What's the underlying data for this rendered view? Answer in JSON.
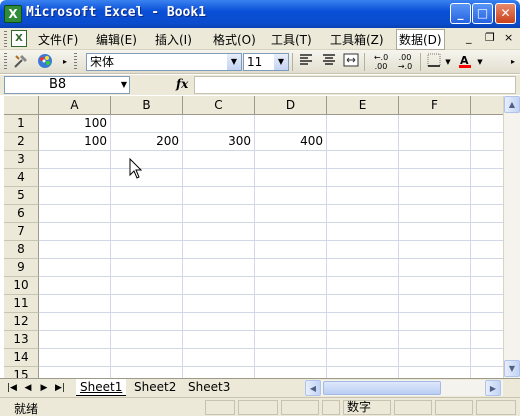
{
  "window": {
    "title": "Microsoft Excel - Book1",
    "app_icon": "excel-icon",
    "buttons": {
      "minimize": "_",
      "maximize": "□",
      "close": "✕"
    }
  },
  "menu": {
    "items": [
      "文件(F)",
      "编辑(E)",
      "插入(I)",
      "格式(O)",
      "工具(T)",
      "工具箱(Z)",
      "数据(D)"
    ],
    "mdi": {
      "minimize": "_",
      "restore": "❐",
      "close": "×"
    }
  },
  "toolbar": {
    "font_name": "宋体",
    "font_size": "11",
    "icons": [
      "tools-icon",
      "palette-icon",
      "align-left-icon",
      "align-center-icon",
      "merge-center-icon",
      "increase-decimal-icon",
      "decrease-decimal-icon",
      "borders-icon",
      "font-color-icon"
    ],
    "font_color": "#ff0000"
  },
  "formula_bar": {
    "name_box": "B8",
    "fx_label": "fx",
    "formula": ""
  },
  "sheet": {
    "columns": [
      "A",
      "B",
      "C",
      "D",
      "E",
      "F"
    ],
    "rows": [
      "1",
      "2",
      "3",
      "4",
      "5",
      "6",
      "7",
      "8",
      "9",
      "10",
      "11",
      "12",
      "13",
      "14",
      "15"
    ],
    "cells": {
      "A1": "100",
      "A2": "100",
      "B2": "200",
      "C2": "300",
      "D2": "400"
    }
  },
  "tabs": {
    "sheets": [
      "Sheet1",
      "Sheet2",
      "Sheet3"
    ],
    "active": "Sheet1"
  },
  "status": {
    "ready": "就绪",
    "num": "数字"
  },
  "colors": {
    "titlebar": "#0a4fd8",
    "chrome": "#ece9d8",
    "gridline": "#d0d7e5"
  }
}
